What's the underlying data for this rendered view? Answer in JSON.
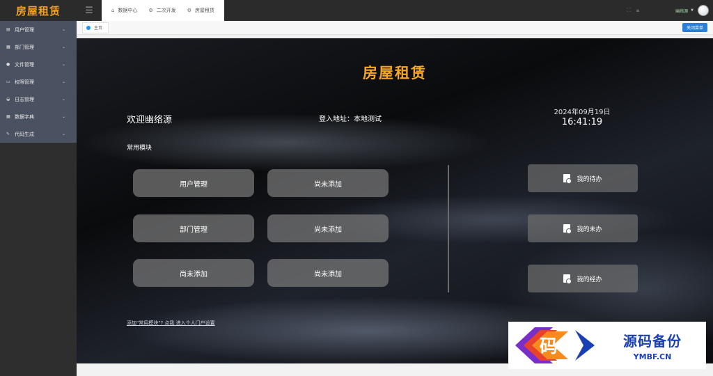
{
  "app": {
    "title": "房屋租赁"
  },
  "sidebar": {
    "items": [
      {
        "icon": "user-card-icon",
        "label": "用户管理"
      },
      {
        "icon": "grid-icon",
        "label": "部门管理"
      },
      {
        "icon": "circle-icon",
        "label": "文件管理"
      },
      {
        "icon": "monitor-icon",
        "label": "权限管理"
      },
      {
        "icon": "disk-icon",
        "label": "日志管理"
      },
      {
        "icon": "grid-icon",
        "label": "数据字典"
      },
      {
        "icon": "pencil-icon",
        "label": "代码生成"
      }
    ]
  },
  "topnav": {
    "items": [
      {
        "icon": "home-icon",
        "label": "数据中心"
      },
      {
        "icon": "gear-icon",
        "label": "二次开发"
      },
      {
        "icon": "gear-icon",
        "label": "房屋租赁"
      }
    ]
  },
  "user": {
    "name": "幽络源"
  },
  "tabs": {
    "home": "主页",
    "close_menu": "关闭菜单"
  },
  "dashboard": {
    "title": "房屋租赁",
    "welcome": "欢迎幽络源",
    "login_address": "登入地址：本地测试",
    "date": "2024年09月19日",
    "time": "16:41:19",
    "section_label": "常用模块",
    "modules": [
      "用户管理",
      "尚未添加",
      "部门管理",
      "尚未添加",
      "尚未添加",
      "尚未添加"
    ],
    "tasks": [
      "我的待办",
      "我的未办",
      "我的经办"
    ],
    "add_link": "添加\"常用模块\"? 点我 进入个人门户设置"
  },
  "watermark": {
    "cn": "源码备份",
    "en": "YMBF.CN",
    "logo_char": "码"
  },
  "colors": {
    "accent": "#f5a623",
    "link_blue": "#2a7fd6",
    "watermark_blue": "#1a3fb3"
  }
}
